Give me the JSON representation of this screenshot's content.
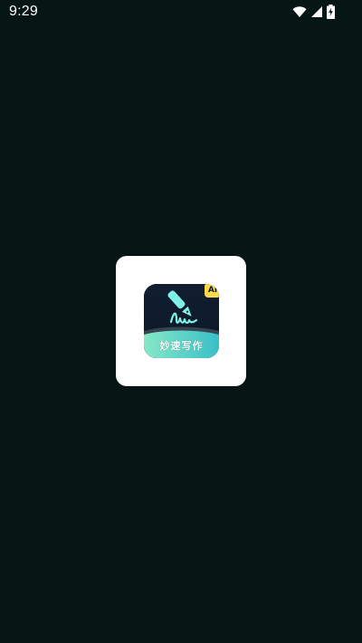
{
  "status_bar": {
    "time": "9:29",
    "icons": [
      "wifi-icon",
      "cellular-signal-icon",
      "battery-charging-icon"
    ]
  },
  "splash": {
    "app_name": "妙速写作",
    "badge": "AI",
    "icon": "fountain-pen-signature-icon",
    "colors": {
      "background": "#061615",
      "card": "#ffffff",
      "icon_top": "#0d1b2a",
      "icon_bottom_start": "#7fe3c4",
      "icon_bottom_end": "#3cc1c8",
      "pen": "#7ef0e6",
      "badge": "#ffd94a"
    }
  }
}
